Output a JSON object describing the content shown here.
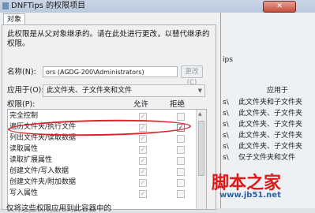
{
  "window": {
    "title": "DNFTips 的权限项目",
    "close_label": "✕"
  },
  "tab": {
    "label": "对象"
  },
  "description": "此权限是从父对象继承的。请在此处进行更改，以替代继承的权限。",
  "name_row": {
    "label": "名称(N):",
    "value": "ors (AGDG-200\\Administrators)",
    "change_button": "更改(C)"
  },
  "apply_row": {
    "label": "应用于(O):",
    "selected": "此文件夹、子文件夹和文件"
  },
  "permissions": {
    "label": "权限(P):",
    "allow_header": "允许",
    "deny_header": "拒绝",
    "rows": [
      {
        "name": "完全控制",
        "allow": true,
        "deny": false
      },
      {
        "name": "遍历文件夹/执行文件",
        "allow": true,
        "deny": true
      },
      {
        "name": "列出文件夹/读取数据",
        "allow": true,
        "deny": false
      },
      {
        "name": "读取属性",
        "allow": true,
        "deny": false
      },
      {
        "name": "读取扩展属性",
        "allow": true,
        "deny": false
      },
      {
        "name": "创建文件/写入数据",
        "allow": true,
        "deny": false
      },
      {
        "name": "创建文件夹/附加数据",
        "allow": true,
        "deny": false
      },
      {
        "name": "写入属性",
        "allow": true,
        "deny": false
      }
    ]
  },
  "bottom_note": "仅将这些权限应用到此容器中的",
  "background_window": {
    "tips_text": "ips",
    "apply_header": "应用于",
    "apply_items": [
      "此文件夹和子文件夹",
      "此文件夹、子文件夹",
      "此文件夹、子文件夹",
      "此文件夹、子文件夹",
      "此文件夹、子文件夹",
      "仅子文件夹和文件"
    ]
  },
  "watermark": {
    "main": "脚本之家",
    "url": "www.jb51.net"
  }
}
